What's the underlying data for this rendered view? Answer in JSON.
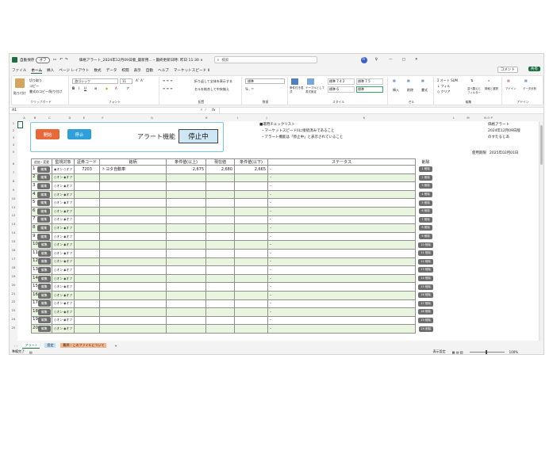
{
  "titlebar": {
    "autosave": "自動保存",
    "autosave_state": "オフ",
    "doc_title": "価格アラート_2024年12月09日版_最新用...・最終更新日時: 昨日 11:30 ∨",
    "search": "検索",
    "user_initial": "R"
  },
  "menu": [
    "ファイル",
    "ホーム",
    "挿入",
    "ページ レイアウト",
    "数式",
    "データ",
    "校閲",
    "表示",
    "自動",
    "ヘルプ",
    "マーケットスピード II"
  ],
  "menu_right": {
    "comment": "コメント",
    "share": "共有"
  },
  "ribbon": {
    "clipboard": {
      "paste": "貼り付け",
      "cut": "切り取り",
      "copy": "コピー",
      "format": "書式のコピー/貼り付け",
      "label": "クリップボード"
    },
    "font": {
      "name": "游ゴシック",
      "size": "11",
      "label": "フォント"
    },
    "align": {
      "wrap": "折り返して全体を表示する",
      "merge": "セルを結合して中央揃え",
      "label": "配置"
    },
    "number": {
      "format": "標準",
      "label": "数値"
    },
    "style": {
      "cond": "条件付き書式",
      "table": "テーブルとして書式設定",
      "s1": "標準 7 4 2",
      "s2": "標準 7 5",
      "s3": "標準 6",
      "s4": "標準",
      "label": "スタイル"
    },
    "cells": {
      "insert": "挿入",
      "delete": "削除",
      "format": "書式",
      "label": "セル"
    },
    "edit": {
      "autosum": "オート SUM",
      "fill": "フィル",
      "clear": "クリア",
      "sort": "並べ替えとフィルター",
      "find": "検索と選択",
      "label": "編集"
    },
    "addins": {
      "addin": "アドイン",
      "analyze": "データ分析",
      "label": "アドイン"
    }
  },
  "formula_bar": {
    "cell": "A1",
    "fx": "fx"
  },
  "columns": [
    "A",
    "B",
    "C",
    "D",
    "E",
    "F",
    "G",
    "H",
    "I",
    "J",
    "K",
    "L",
    "M",
    "N O P"
  ],
  "rows": [
    "1",
    "2",
    "3",
    "4",
    "5",
    "6",
    "7",
    "8",
    "9",
    "10",
    "11",
    "12",
    "13",
    "14",
    "15",
    "16",
    "17",
    "18",
    "19",
    "20",
    "21",
    "22",
    "23",
    "24",
    "25"
  ],
  "panel": {
    "start": "開始",
    "stop": "停止",
    "alert_label": "アラート機能",
    "alert_status": "停止中"
  },
  "checklist": {
    "title": "■運用チェックリスト",
    "item1": "・マーケットスピードIIに接続済みであること",
    "item2": "・アラート機能は「停止中」と表示されていること"
  },
  "info": {
    "app": "価格アラート",
    "date": "2024年12月09日版",
    "author": "のすたるじあ",
    "deadline_label": "使用期限",
    "deadline": "2025年02月01日"
  },
  "table": {
    "headers": [
      "追加・変更",
      "監視対象",
      "証券コード",
      "銘柄",
      "条件値(以上)",
      "現在値",
      "条件値(以下)",
      "ステータス",
      "削除"
    ],
    "edit_label": "編集",
    "on_label": "オン",
    "off_label": "オフ",
    "rows": [
      {
        "no": "1",
        "code": "7203",
        "name": "トヨタ自動車",
        "above": "2,675",
        "current": "2,680",
        "below": "2,665",
        "status": "-",
        "del": "1 削除",
        "on": true
      },
      {
        "no": "2",
        "code": "",
        "name": "",
        "above": "",
        "current": "",
        "below": "",
        "status": "-",
        "del": "2 削除",
        "on": false
      },
      {
        "no": "3",
        "code": "",
        "name": "",
        "above": "",
        "current": "",
        "below": "",
        "status": "-",
        "del": "3 削除",
        "on": false
      },
      {
        "no": "4",
        "code": "",
        "name": "",
        "above": "",
        "current": "",
        "below": "",
        "status": "-",
        "del": "4 削除",
        "on": false
      },
      {
        "no": "5",
        "code": "",
        "name": "",
        "above": "",
        "current": "",
        "below": "",
        "status": "-",
        "del": "5 削除",
        "on": false
      },
      {
        "no": "6",
        "code": "",
        "name": "",
        "above": "",
        "current": "",
        "below": "",
        "status": "-",
        "del": "6 削除",
        "on": false
      },
      {
        "no": "7",
        "code": "",
        "name": "",
        "above": "",
        "current": "",
        "below": "",
        "status": "-",
        "del": "7 削除",
        "on": false
      },
      {
        "no": "8",
        "code": "",
        "name": "",
        "above": "",
        "current": "",
        "below": "",
        "status": "-",
        "del": "8 削除",
        "on": false
      },
      {
        "no": "9",
        "code": "",
        "name": "",
        "above": "",
        "current": "",
        "below": "",
        "status": "-",
        "del": "9 削除",
        "on": false
      },
      {
        "no": "10",
        "code": "",
        "name": "",
        "above": "",
        "current": "",
        "below": "",
        "status": "-",
        "del": "10 削除",
        "on": false
      },
      {
        "no": "11",
        "code": "",
        "name": "",
        "above": "",
        "current": "",
        "below": "",
        "status": "-",
        "del": "11 削除",
        "on": false
      },
      {
        "no": "12",
        "code": "",
        "name": "",
        "above": "",
        "current": "",
        "below": "",
        "status": "-",
        "del": "12 削除",
        "on": false
      },
      {
        "no": "13",
        "code": "",
        "name": "",
        "above": "",
        "current": "",
        "below": "",
        "status": "-",
        "del": "13 削除",
        "on": false
      },
      {
        "no": "14",
        "code": "",
        "name": "",
        "above": "",
        "current": "",
        "below": "",
        "status": "-",
        "del": "14 削除",
        "on": false
      },
      {
        "no": "15",
        "code": "",
        "name": "",
        "above": "",
        "current": "",
        "below": "",
        "status": "-",
        "del": "15 削除",
        "on": false
      },
      {
        "no": "16",
        "code": "",
        "name": "",
        "above": "",
        "current": "",
        "below": "",
        "status": "-",
        "del": "16 削除",
        "on": false
      },
      {
        "no": "17",
        "code": "",
        "name": "",
        "above": "",
        "current": "",
        "below": "",
        "status": "-",
        "del": "17 削除",
        "on": false
      },
      {
        "no": "18",
        "code": "",
        "name": "",
        "above": "",
        "current": "",
        "below": "",
        "status": "-",
        "del": "18 削除",
        "on": false
      },
      {
        "no": "19",
        "code": "",
        "name": "",
        "above": "",
        "current": "",
        "below": "",
        "status": "-",
        "del": "19 削除",
        "on": false
      },
      {
        "no": "20",
        "code": "",
        "name": "",
        "above": "",
        "current": "",
        "below": "",
        "status": "-",
        "del": "20 削除",
        "on": false
      }
    ]
  },
  "sheet_tabs": [
    "アラート",
    "設定",
    "難問・このファイルについて"
  ],
  "statusbar": {
    "ready": "準備完了",
    "display": "表示設定",
    "zoom": "100%"
  }
}
